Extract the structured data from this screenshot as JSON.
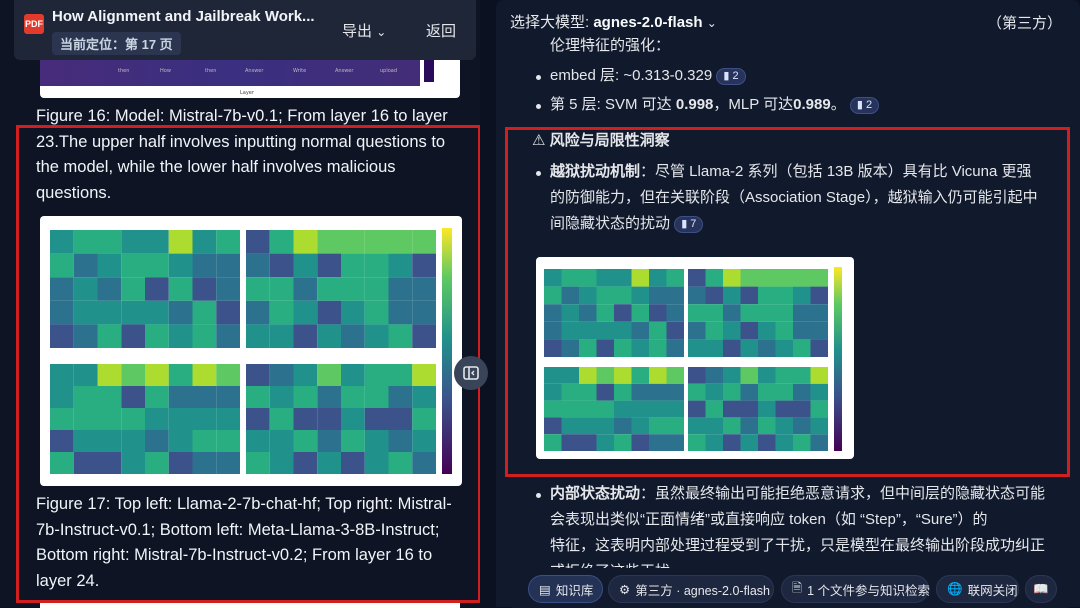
{
  "left_panel": {
    "doc_title": "How Alignment and Jailbreak Work...",
    "location": "当前定位：第 17 页",
    "export_label": "导出",
    "back_label": "返回",
    "figure16_caption": "Figure 16: Model: Mistral-7b-v0.1; From layer 16 to layer 23.The upper half involves inputting normal questions to the model, while the lower half involves malicious questions.",
    "figure17_caption": "Figure 17: Top left: Llama-2-7b-chat-hf; Top right: Mistral-7b-Instruct-v0.1; Bottom left: Meta-Llama-3-8B-Instruct; Bottom right: Mistral-7b-Instruct-v0.2; From layer 16 to layer 24."
  },
  "right_panel": {
    "model_prefix": "选择大模型: ",
    "model_name": "agnes-2.0-flash",
    "third_party": "（第三方）",
    "line_ethics": "伦理特征的强化：",
    "embed_text": "embed 层: ~0.313-0.329",
    "embed_cite": "2",
    "layer5_pre": "第 5 层: SVM 可达 ",
    "layer5_svm": "0.998",
    "layer5_mid": "，MLP 可达",
    "layer5_mlp": "0.989",
    "layer5_post": "。",
    "layer5_cite": "2",
    "risk_heading": "风险与局限性洞察",
    "jailbreak_title": "越狱扰动机制",
    "jailbreak_line1": "：尽管 Llama-2 系列（包括 13B 版本）具有比 Vicuna 更强",
    "jailbreak_line2": "的防御能力，但在关联阶段（Association Stage），越狱输入仍可能引起中",
    "jailbreak_line3": "间隐藏状态的扰动",
    "jailbreak_cite": "7",
    "internal_title": "内部状态扰动",
    "internal_line1": "：虽然最终输出可能拒绝恶意请求，但中间层的隐藏状态可能",
    "internal_line2": "会表现出类似“正面情绪”或直接响应 token（如 “Step”，“Sure”）的",
    "internal_line3": "特征，这表明内部处理过程受到了干扰，只是模型在最终输出阶段成功纠正",
    "internal_line4": "或拒绝了这些干扰"
  },
  "bottom_bar": {
    "kb_label": "知识库",
    "model_label": "第三方 · agnes-2.0-flash",
    "files_label": "1 个文件参与知识检索",
    "web_label": "联网关闭"
  },
  "colors": {
    "highlight_red": "#d11f1f",
    "background": "#0b1120",
    "panel": "#111a2c",
    "cite_badge": "#27335a"
  }
}
